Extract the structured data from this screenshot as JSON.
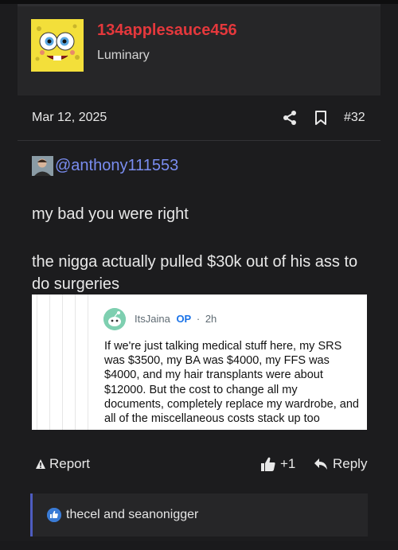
{
  "post": {
    "username": "134applesauce456",
    "rank": "Luminary",
    "date": "Mar 12, 2025",
    "post_number": "#32",
    "mention": "@anthony111553",
    "line1": "my bad you were right",
    "line2": "the nigga actually pulled $30k out of his ass to do surgeries"
  },
  "embedded_comment": {
    "author": "ItsJaina",
    "op_badge": "OP",
    "separator": "·",
    "time": "2h",
    "text": "If we're just talking medical stuff here, my SRS was $3500, my BA was $4000, my FFS was $4000, and my hair transplants were about $12000. But the cost to change all my documents, completely replace my wardrobe, and all of the miscellaneous costs stack up too"
  },
  "actions": {
    "report_label": "Report",
    "like_count": "+1",
    "reply_label": "Reply"
  },
  "reactions": {
    "text": "thecel and seanonigger"
  },
  "colors": {
    "background": "#1c1c1e",
    "panel": "#262628",
    "username": "#e4383c",
    "mention": "#7a8df0",
    "reaction_accent": "#4e5cc0",
    "op_badge": "#1a73e8"
  },
  "icons": {
    "share": "share-icon",
    "bookmark": "bookmark-icon",
    "report": "warning-triangle-icon",
    "like": "thumbs-up-icon",
    "reply": "reply-arrow-icon",
    "reaction": "like-reaction-icon"
  }
}
